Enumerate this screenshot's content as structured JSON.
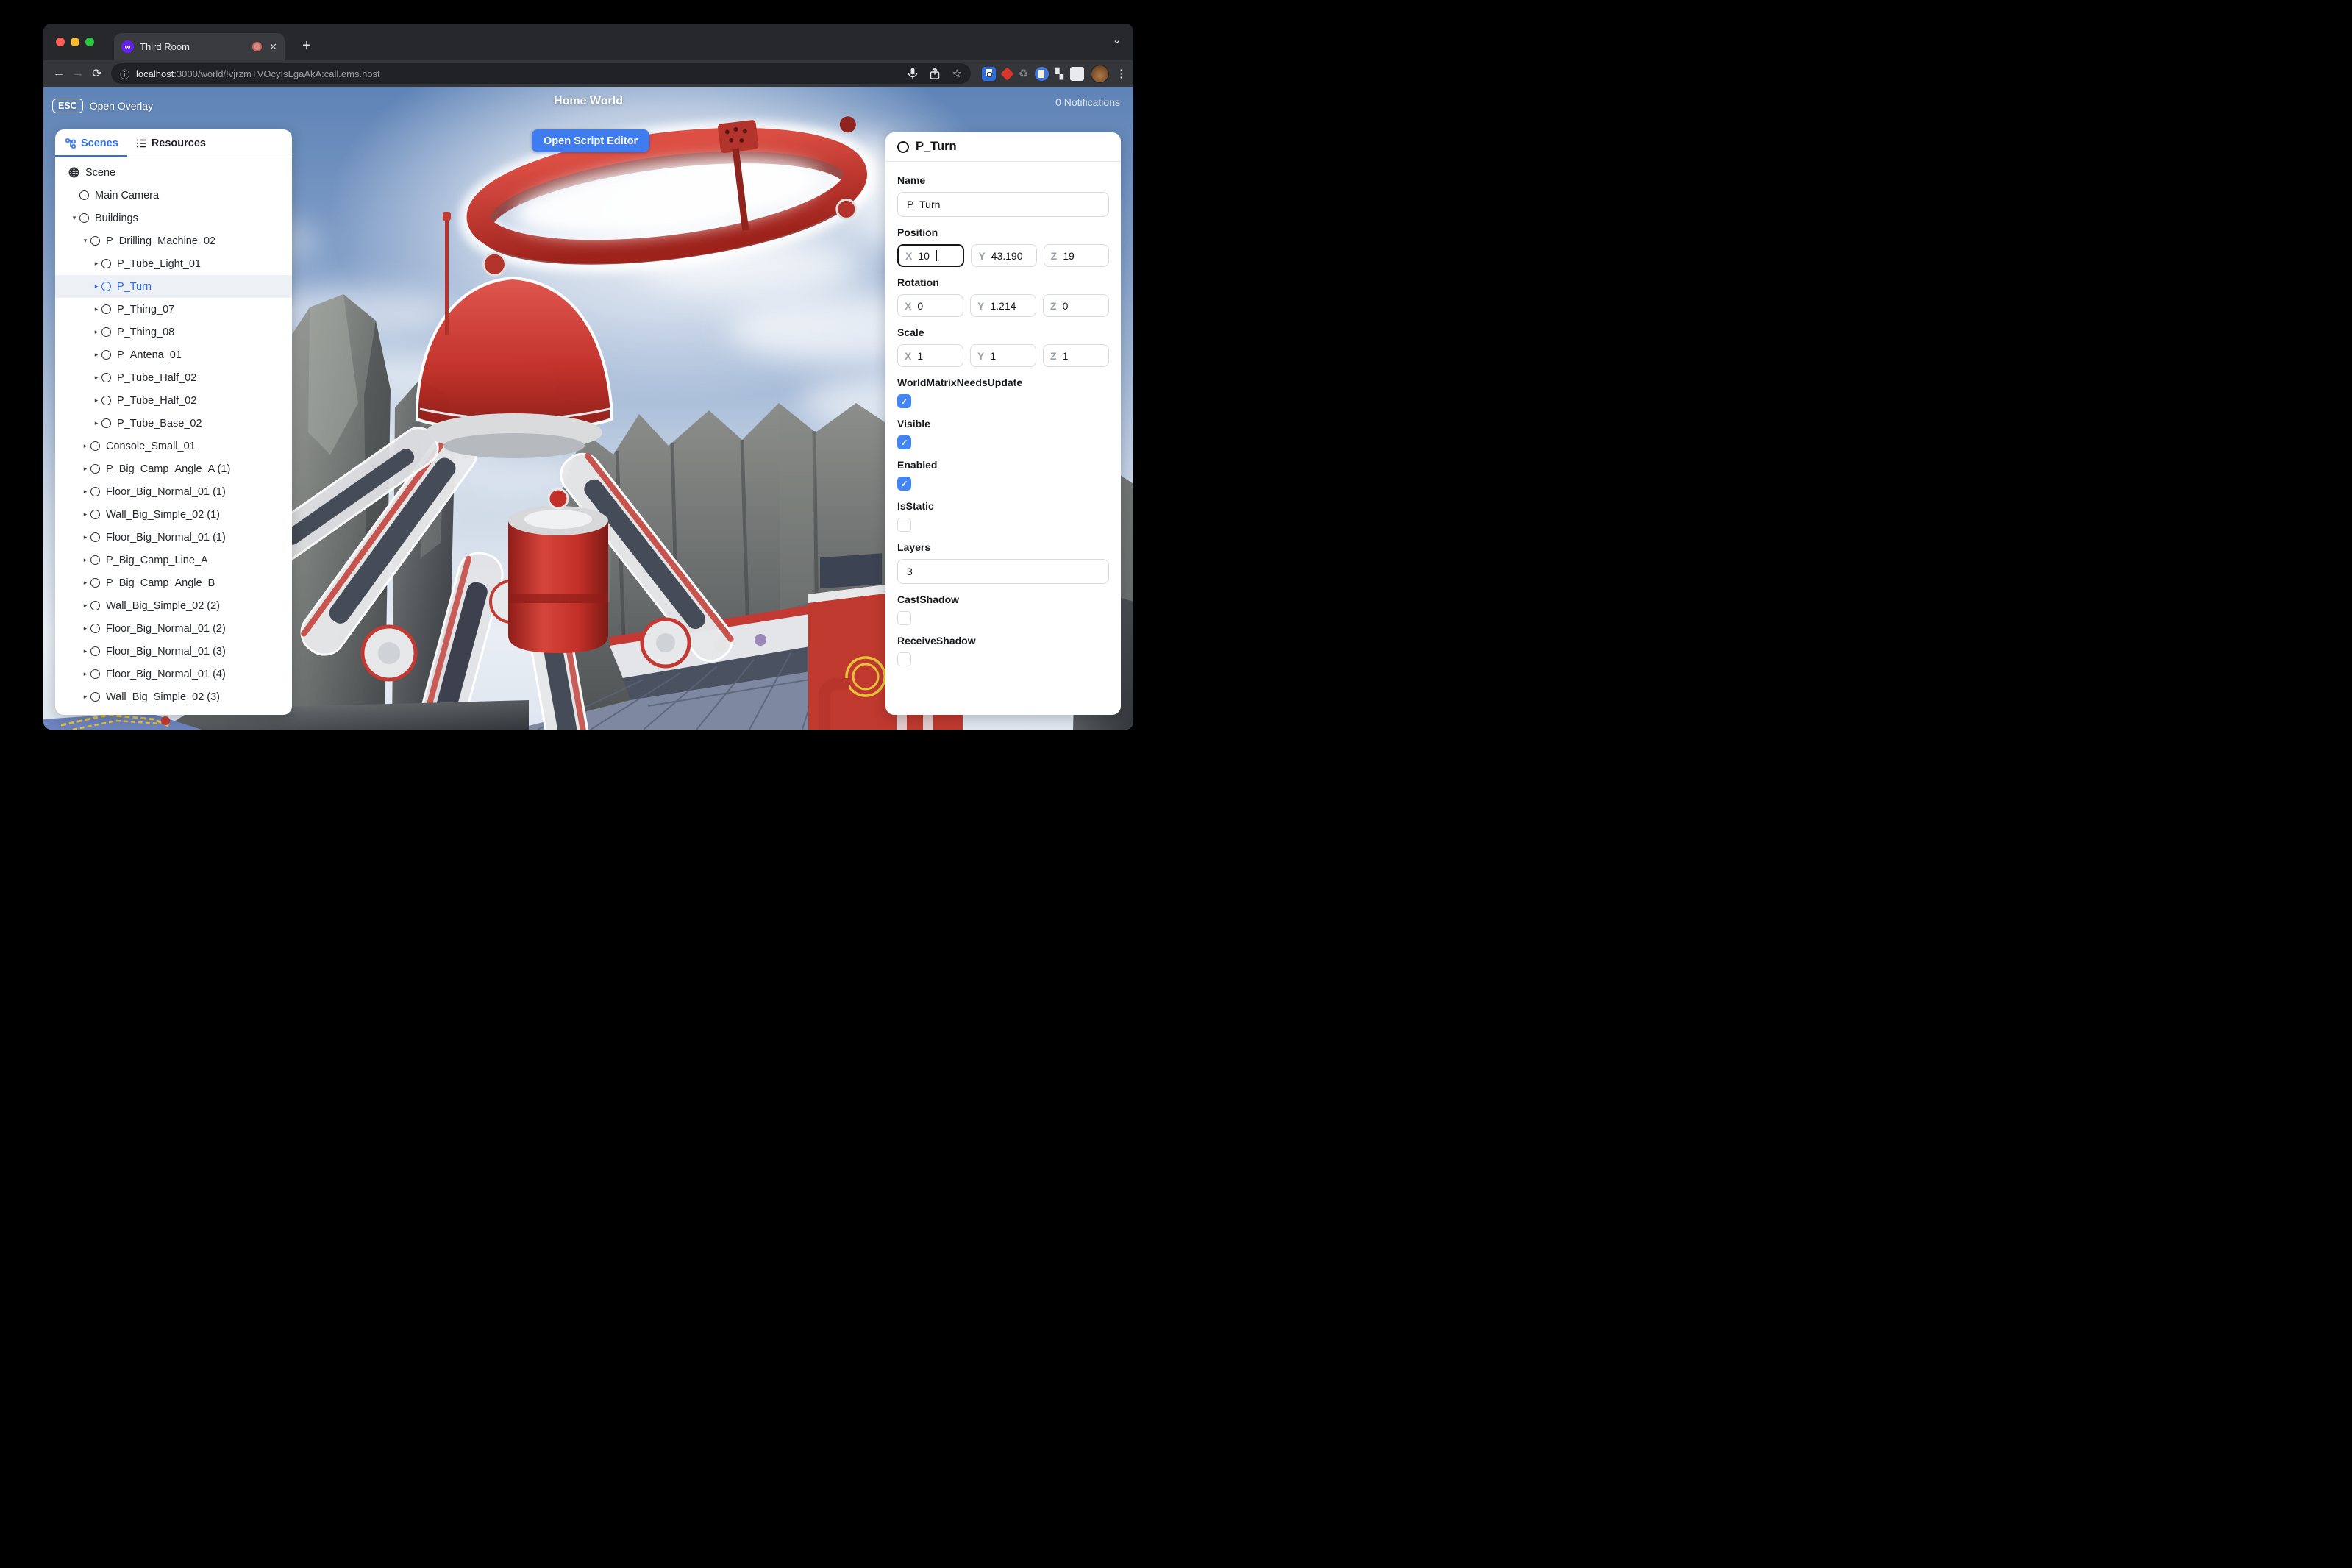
{
  "browser": {
    "tab_title": "Third Room",
    "url_host": "localhost",
    "url_rest": ":3000/world/!vjrzmTVOcyIsLgaAkA:call.ems.host",
    "glyphs": {
      "close": "✕",
      "new_tab": "+",
      "chevron_down": "⌄",
      "back": "←",
      "forward": "→",
      "reload": "⟳",
      "info": "ⓘ",
      "star": "☆",
      "recycle": "♻",
      "puzzle": "▚",
      "more": "⋮",
      "favicon": "∞"
    }
  },
  "overlay": {
    "esc_key": "ESC",
    "esc_label": "Open Overlay",
    "world_title": "Home World",
    "notifications": "0 Notifications",
    "script_editor_button": "Open Script Editor"
  },
  "scene_panel": {
    "tabs": [
      {
        "label": "Scenes"
      },
      {
        "label": "Resources"
      }
    ],
    "tree": [
      {
        "label": "Scene",
        "level": 0,
        "caret": "none",
        "icon": "globe",
        "selected": false
      },
      {
        "label": "Main Camera",
        "level": 1,
        "caret": "none",
        "icon": "node",
        "selected": false
      },
      {
        "label": "Buildings",
        "level": 1,
        "caret": "down",
        "icon": "node",
        "selected": false
      },
      {
        "label": "P_Drilling_Machine_02",
        "level": 2,
        "caret": "down",
        "icon": "node",
        "selected": false
      },
      {
        "label": "P_Tube_Light_01",
        "level": 3,
        "caret": "right",
        "icon": "node",
        "selected": false
      },
      {
        "label": "P_Turn",
        "level": 3,
        "caret": "right",
        "icon": "node",
        "selected": true
      },
      {
        "label": "P_Thing_07",
        "level": 3,
        "caret": "right",
        "icon": "node",
        "selected": false
      },
      {
        "label": "P_Thing_08",
        "level": 3,
        "caret": "right",
        "icon": "node",
        "selected": false
      },
      {
        "label": "P_Antena_01",
        "level": 3,
        "caret": "right",
        "icon": "node",
        "selected": false
      },
      {
        "label": "P_Tube_Half_02",
        "level": 3,
        "caret": "right",
        "icon": "node",
        "selected": false
      },
      {
        "label": "P_Tube_Half_02",
        "level": 3,
        "caret": "right",
        "icon": "node",
        "selected": false
      },
      {
        "label": "P_Tube_Base_02",
        "level": 3,
        "caret": "right",
        "icon": "node",
        "selected": false
      },
      {
        "label": "Console_Small_01",
        "level": 2,
        "caret": "right",
        "icon": "node",
        "selected": false
      },
      {
        "label": "P_Big_Camp_Angle_A (1)",
        "level": 2,
        "caret": "right",
        "icon": "node",
        "selected": false
      },
      {
        "label": "Floor_Big_Normal_01 (1)",
        "level": 2,
        "caret": "right",
        "icon": "node",
        "selected": false
      },
      {
        "label": "Wall_Big_Simple_02 (1)",
        "level": 2,
        "caret": "right",
        "icon": "node",
        "selected": false
      },
      {
        "label": "Floor_Big_Normal_01 (1)",
        "level": 2,
        "caret": "right",
        "icon": "node",
        "selected": false
      },
      {
        "label": "P_Big_Camp_Line_A",
        "level": 2,
        "caret": "right",
        "icon": "node",
        "selected": false
      },
      {
        "label": "P_Big_Camp_Angle_B",
        "level": 2,
        "caret": "right",
        "icon": "node",
        "selected": false
      },
      {
        "label": "Wall_Big_Simple_02 (2)",
        "level": 2,
        "caret": "right",
        "icon": "node",
        "selected": false
      },
      {
        "label": "Floor_Big_Normal_01 (2)",
        "level": 2,
        "caret": "right",
        "icon": "node",
        "selected": false
      },
      {
        "label": "Floor_Big_Normal_01 (3)",
        "level": 2,
        "caret": "right",
        "icon": "node",
        "selected": false
      },
      {
        "label": "Floor_Big_Normal_01 (4)",
        "level": 2,
        "caret": "right",
        "icon": "node",
        "selected": false
      },
      {
        "label": "Wall_Big_Simple_02 (3)",
        "level": 2,
        "caret": "right",
        "icon": "node",
        "selected": false
      }
    ]
  },
  "inspector": {
    "title": "P_Turn",
    "name_label": "Name",
    "name_value": "P_Turn",
    "axis_labels": {
      "x": "X",
      "y": "Y",
      "z": "Z"
    },
    "vectors": [
      {
        "label": "Position",
        "x": "10",
        "y": "43.190",
        "z": "19",
        "focused_axis": "x"
      },
      {
        "label": "Rotation",
        "x": "0",
        "y": "1.214",
        "z": "0",
        "focused_axis": ""
      },
      {
        "label": "Scale",
        "x": "1",
        "y": "1",
        "z": "1",
        "focused_axis": ""
      }
    ],
    "bool_fields": [
      {
        "label": "WorldMatrixNeedsUpdate",
        "checked": true
      },
      {
        "label": "Visible",
        "checked": true
      },
      {
        "label": "Enabled",
        "checked": true
      },
      {
        "label": "IsStatic",
        "checked": false
      }
    ],
    "layers_label": "Layers",
    "layers_value": "3",
    "shadow_fields": [
      {
        "label": "CastShadow",
        "checked": false
      },
      {
        "label": "ReceiveShadow",
        "checked": false
      }
    ],
    "check_glyph": "✓"
  },
  "colors": {
    "accent_blue": "#3e7cf0",
    "checkbox_blue": "#4285f4",
    "selection_blue": "#2e6ff2",
    "machine_red": "#c23028",
    "sky_top": "#5e83b6"
  }
}
